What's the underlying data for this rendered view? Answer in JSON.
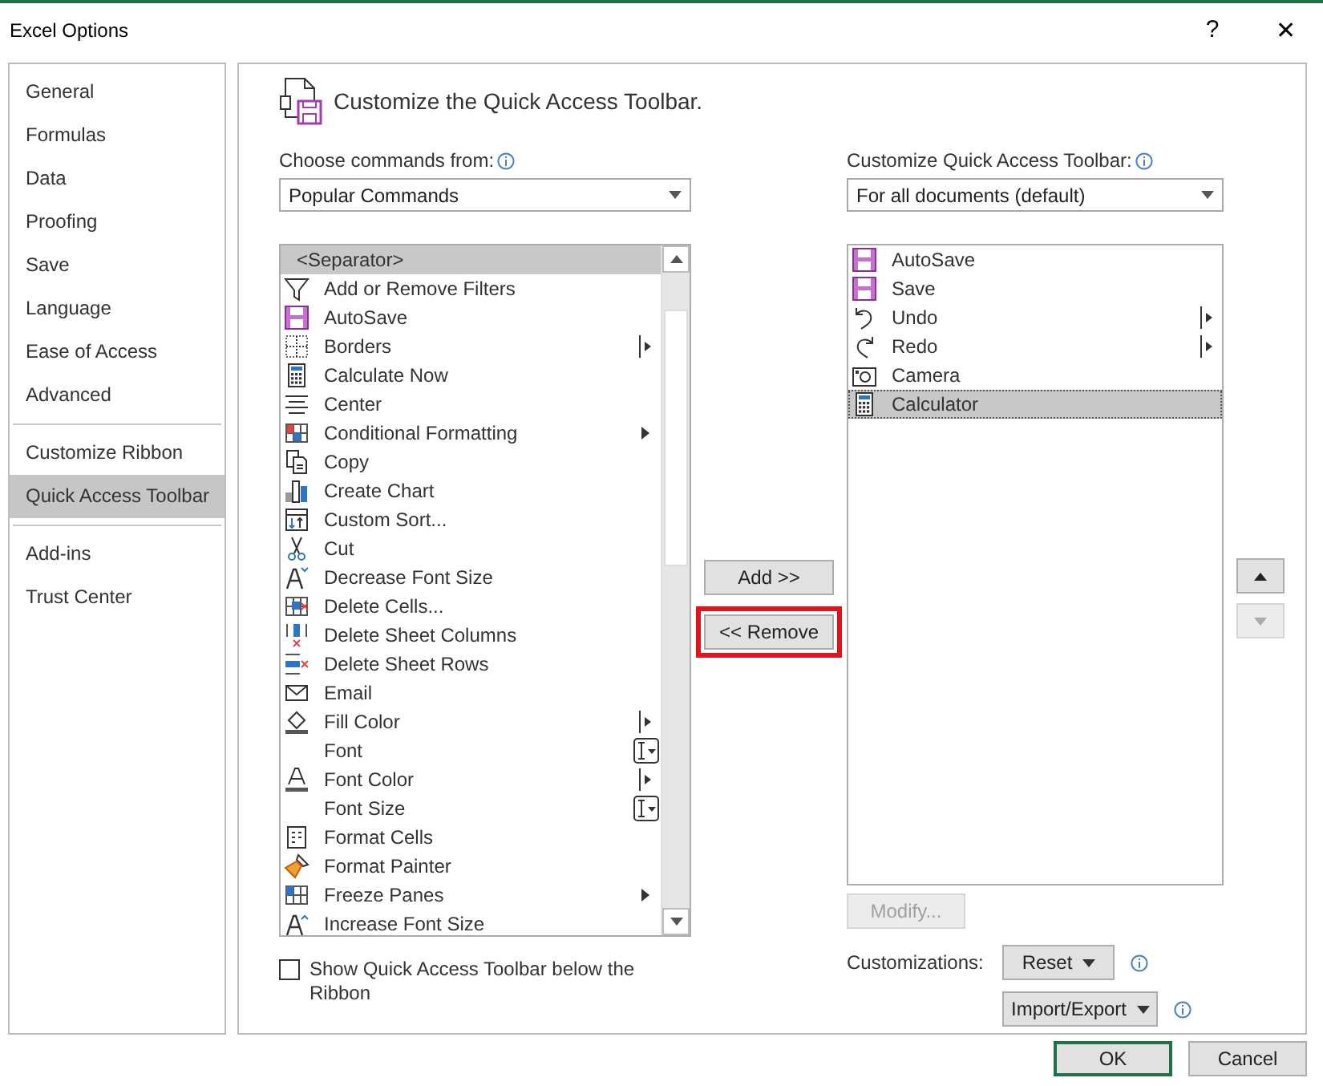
{
  "window": {
    "title": "Excel Options",
    "help": "?",
    "close": "✕"
  },
  "sidebar": {
    "sections": [
      [
        {
          "label": "General",
          "selected": false
        },
        {
          "label": "Formulas",
          "selected": false
        },
        {
          "label": "Data",
          "selected": false
        },
        {
          "label": "Proofing",
          "selected": false
        },
        {
          "label": "Save",
          "selected": false
        },
        {
          "label": "Language",
          "selected": false
        },
        {
          "label": "Ease of Access",
          "selected": false
        },
        {
          "label": "Advanced",
          "selected": false
        }
      ],
      [
        {
          "label": "Customize Ribbon",
          "selected": false
        },
        {
          "label": "Quick Access Toolbar",
          "selected": true
        }
      ],
      [
        {
          "label": "Add-ins",
          "selected": false
        },
        {
          "label": "Trust Center",
          "selected": false
        }
      ]
    ]
  },
  "heading": "Customize the Quick Access Toolbar.",
  "choose_label": "Choose commands from:",
  "choose_value": "Popular Commands",
  "target_label": "Customize Quick Access Toolbar:",
  "target_value": "For all documents (default)",
  "commands": [
    {
      "label": "<Separator>",
      "selected": true,
      "kind": "separator"
    },
    {
      "label": "Add or Remove Filters",
      "selected": false,
      "kind": "plain"
    },
    {
      "label": "AutoSave",
      "selected": false,
      "kind": "plain"
    },
    {
      "label": "Borders",
      "selected": false,
      "kind": "split"
    },
    {
      "label": "Calculate Now",
      "selected": false,
      "kind": "plain"
    },
    {
      "label": "Center",
      "selected": false,
      "kind": "plain"
    },
    {
      "label": "Conditional Formatting",
      "selected": false,
      "kind": "submenu"
    },
    {
      "label": "Copy",
      "selected": false,
      "kind": "plain"
    },
    {
      "label": "Create Chart",
      "selected": false,
      "kind": "plain"
    },
    {
      "label": "Custom Sort...",
      "selected": false,
      "kind": "plain"
    },
    {
      "label": "Cut",
      "selected": false,
      "kind": "plain"
    },
    {
      "label": "Decrease Font Size",
      "selected": false,
      "kind": "plain"
    },
    {
      "label": "Delete Cells...",
      "selected": false,
      "kind": "plain"
    },
    {
      "label": "Delete Sheet Columns",
      "selected": false,
      "kind": "plain"
    },
    {
      "label": "Delete Sheet Rows",
      "selected": false,
      "kind": "plain"
    },
    {
      "label": "Email",
      "selected": false,
      "kind": "plain"
    },
    {
      "label": "Fill Color",
      "selected": false,
      "kind": "split"
    },
    {
      "label": "Font",
      "selected": false,
      "kind": "combo"
    },
    {
      "label": "Font Color",
      "selected": false,
      "kind": "split"
    },
    {
      "label": "Font Size",
      "selected": false,
      "kind": "combo"
    },
    {
      "label": "Format Cells",
      "selected": false,
      "kind": "plain"
    },
    {
      "label": "Format Painter",
      "selected": false,
      "kind": "plain"
    },
    {
      "label": "Freeze Panes",
      "selected": false,
      "kind": "submenu"
    },
    {
      "label": "Increase Font Size",
      "selected": false,
      "kind": "plain"
    }
  ],
  "toolbar_items": [
    {
      "label": "AutoSave",
      "selected": false,
      "kind": "plain"
    },
    {
      "label": "Save",
      "selected": false,
      "kind": "plain"
    },
    {
      "label": "Undo",
      "selected": false,
      "kind": "split"
    },
    {
      "label": "Redo",
      "selected": false,
      "kind": "split"
    },
    {
      "label": "Camera",
      "selected": false,
      "kind": "plain"
    },
    {
      "label": "Calculator",
      "selected": true,
      "kind": "plain"
    }
  ],
  "add_button": {
    "label": "Add >>"
  },
  "remove_button": {
    "label": "<< Remove",
    "highlighted": true
  },
  "move_up": {
    "disabled": false
  },
  "move_down": {
    "disabled": true
  },
  "show_below": {
    "label": "Show Quick Access Toolbar below the Ribbon",
    "checked": false
  },
  "modify_button": {
    "label": "Modify...",
    "disabled": true
  },
  "customizations_label": "Customizations:",
  "reset_button": "Reset",
  "import_export_button": "Import/Export",
  "footer": {
    "ok": "OK",
    "cancel": "Cancel"
  }
}
